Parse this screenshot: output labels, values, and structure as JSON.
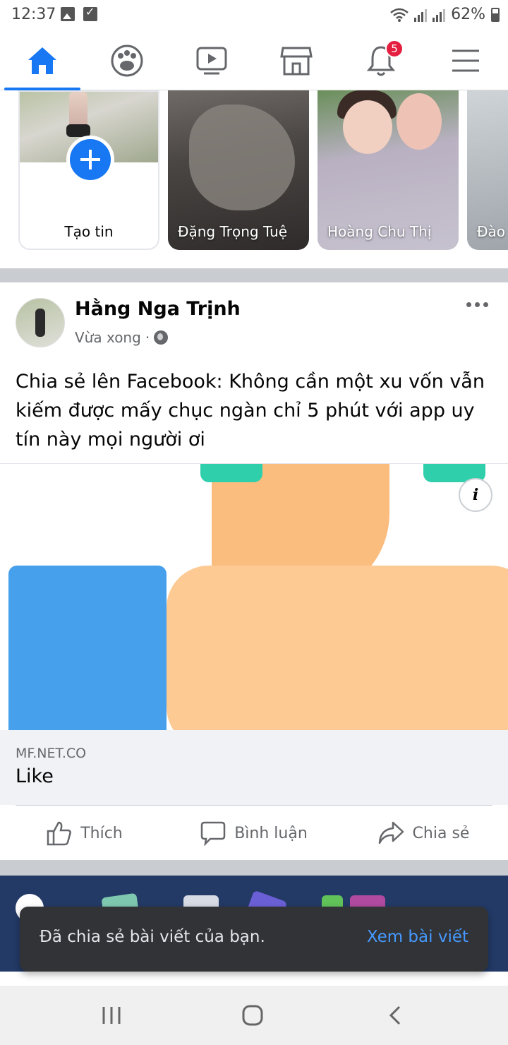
{
  "status_bar": {
    "time": "12:37",
    "battery": "62%"
  },
  "nav": {
    "items": [
      {
        "icon": "home-icon",
        "active": true
      },
      {
        "icon": "groups-icon",
        "active": false
      },
      {
        "icon": "watch-icon",
        "active": false
      },
      {
        "icon": "marketplace-icon",
        "active": false
      },
      {
        "icon": "notifications-icon",
        "active": false
      },
      {
        "icon": "menu-icon",
        "active": false
      }
    ],
    "notification_badge": "5",
    "accent": "#1877f2"
  },
  "stories": {
    "create_label": "Tạo tin",
    "items": [
      {
        "name": "Đặng Trọng Tuệ"
      },
      {
        "name": "Hoàng Chu Thị"
      },
      {
        "name": "Đào"
      }
    ]
  },
  "post": {
    "author": "Hằng Nga Trịnh",
    "time": "Vừa xong",
    "text": "Chia sẻ lên Facebook: Không cần một xu vốn vẫn kiếm được mấy chục ngàn chỉ 5 phút với app uy tín này mọi người ơi",
    "link": {
      "domain": "MF.NET.CO",
      "title": "Like"
    },
    "actions": {
      "like": "Thích",
      "comment": "Bình luận",
      "share": "Chia sẻ"
    }
  },
  "toast": {
    "message": "Đã chia sẻ bài viết của bạn.",
    "action": "Xem bài viết"
  }
}
